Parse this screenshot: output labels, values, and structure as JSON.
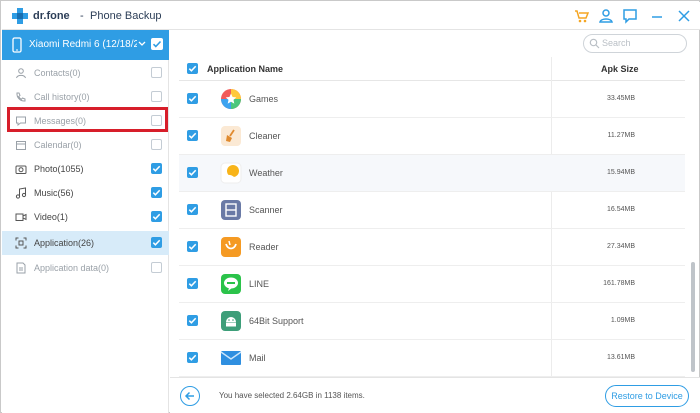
{
  "titlebar": {
    "app_name": "dr.fone",
    "separator": "-",
    "module": "Phone Backup",
    "icons": [
      "logo-plus-icon",
      "cart-icon",
      "user-icon",
      "feedback-icon",
      "minimize-icon",
      "close-icon"
    ],
    "accent": "#2f9de4"
  },
  "sidebar": {
    "device_name": "Xiaomi Redmi 6 (12/18/2",
    "items": [
      {
        "label": "Contacts(0)",
        "icon": "contacts-icon",
        "checked": false,
        "enabled": false
      },
      {
        "label": "Call history(0)",
        "icon": "call-history-icon",
        "checked": false,
        "enabled": false
      },
      {
        "label": "Messages(0)",
        "icon": "messages-icon",
        "checked": false,
        "enabled": false
      },
      {
        "label": "Calendar(0)",
        "icon": "calendar-icon",
        "checked": false,
        "enabled": false
      },
      {
        "label": "Photo(1055)",
        "icon": "photo-icon",
        "checked": true,
        "enabled": true
      },
      {
        "label": "Music(56)",
        "icon": "music-icon",
        "checked": true,
        "enabled": true
      },
      {
        "label": "Video(1)",
        "icon": "video-icon",
        "checked": true,
        "enabled": true
      },
      {
        "label": "Application(26)",
        "icon": "application-icon",
        "checked": true,
        "enabled": true,
        "active": true
      },
      {
        "label": "Application data(0)",
        "icon": "application-data-icon",
        "checked": false,
        "enabled": false
      }
    ],
    "highlight_color": "#d71e2a"
  },
  "search": {
    "placeholder": "Search"
  },
  "table": {
    "columns": [
      "Application Name",
      "Apk Size"
    ],
    "rows": [
      {
        "name": "Games",
        "size": "33.45MB",
        "icon": "games-star-icon"
      },
      {
        "name": "Cleaner",
        "size": "11.27MB",
        "icon": "cleaner-broom-icon"
      },
      {
        "name": "Weather",
        "size": "15.94MB",
        "icon": "weather-sun-icon"
      },
      {
        "name": "Scanner",
        "size": "16.54MB",
        "icon": "scanner-icon"
      },
      {
        "name": "Reader",
        "size": "27.34MB",
        "icon": "reader-icon"
      },
      {
        "name": "LINE",
        "size": "161.78MB",
        "icon": "line-chat-icon"
      },
      {
        "name": "64Bit Support",
        "size": "1.09MB",
        "icon": "android-icon"
      },
      {
        "name": "Mail",
        "size": "13.61MB",
        "icon": "mail-icon"
      }
    ]
  },
  "footer": {
    "selection": "You have selected 2.64GB in 1138 items.",
    "restore_label": "Restore to Device"
  }
}
